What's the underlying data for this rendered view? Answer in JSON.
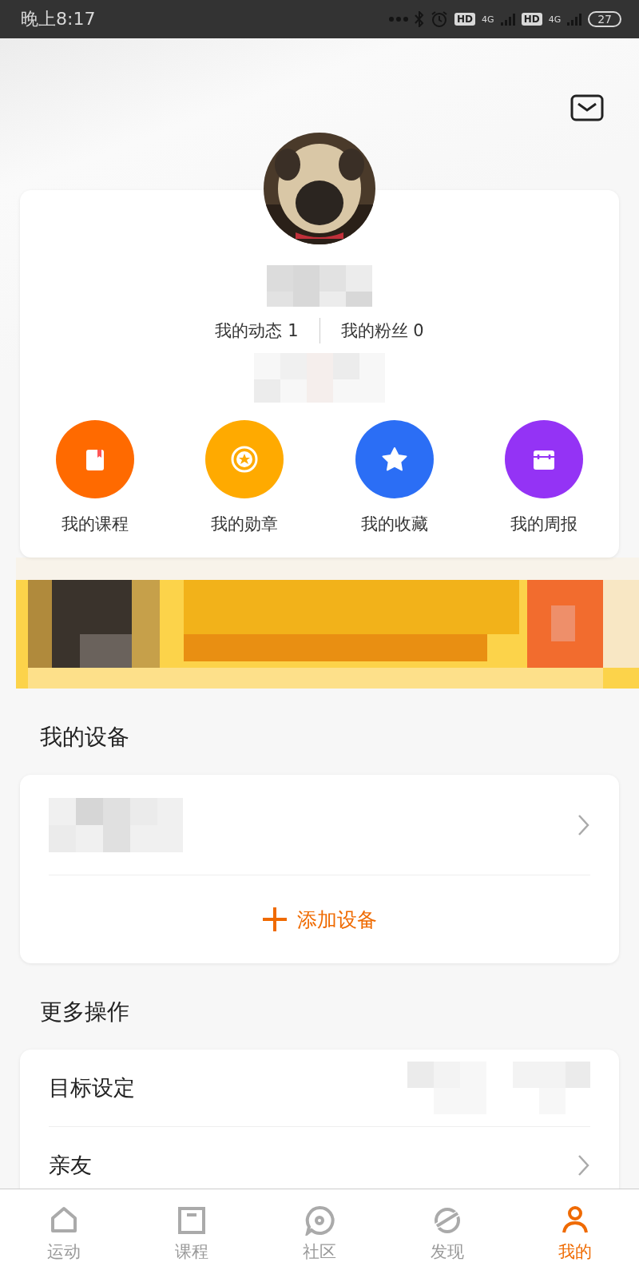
{
  "status_bar": {
    "time": "晚上8:17",
    "hd_1": "HD",
    "network_1": "4G",
    "hd_2": "HD",
    "network_2": "4G",
    "battery": "27"
  },
  "profile": {
    "stats": [
      "我的动态 1",
      "我的粉丝 0"
    ],
    "shortcuts": [
      {
        "label": "我的课程",
        "color": "#ff6a00",
        "kind": "book"
      },
      {
        "label": "我的勋章",
        "color": "#ffaa00",
        "kind": "medal"
      },
      {
        "label": "我的收藏",
        "color": "#2b6ef5",
        "kind": "star"
      },
      {
        "label": "我的周报",
        "color": "#9433f5",
        "kind": "calendar"
      }
    ]
  },
  "devices": {
    "title": "我的设备",
    "add_label": "添加设备"
  },
  "more": {
    "title": "更多操作",
    "items": [
      "目标设定",
      "亲友"
    ]
  },
  "tab_bar": [
    {
      "label": "运动",
      "kind": "home",
      "selected": false
    },
    {
      "label": "课程",
      "kind": "course",
      "selected": false
    },
    {
      "label": "社区",
      "kind": "community",
      "selected": false
    },
    {
      "label": "发现",
      "kind": "discover",
      "selected": false
    },
    {
      "label": "我的",
      "kind": "me",
      "selected": true
    }
  ]
}
